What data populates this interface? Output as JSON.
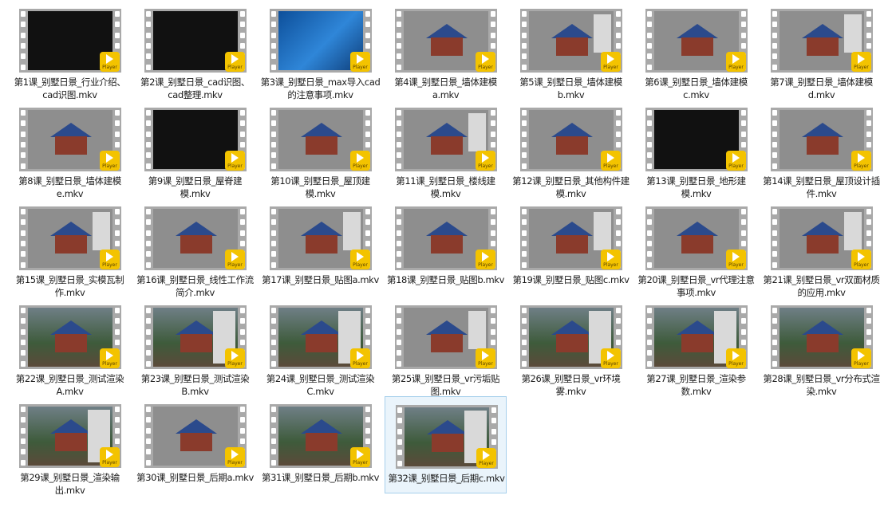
{
  "colors": {
    "badge": "#f3c300",
    "selection_border": "#a7d0ec"
  },
  "player_badge_label": "Player",
  "selected_index": 31,
  "files": [
    {
      "name": "第1课_别墅日景_行业介绍、cad识图.mkv",
      "thumb": "dark"
    },
    {
      "name": "第2课_别墅日景_cad识图、cad整理.mkv",
      "thumb": "dark"
    },
    {
      "name": "第3课_别墅日景_max导入cad的注意事项.mkv",
      "thumb": "blue"
    },
    {
      "name": "第4课_别墅日景_墙体建模a.mkv",
      "thumb": "gray"
    },
    {
      "name": "第5课_别墅日景_墙体建模b.mkv",
      "thumb": "gray"
    },
    {
      "name": "第6课_别墅日景_墙体建模c.mkv",
      "thumb": "gray"
    },
    {
      "name": "第7课_别墅日景_墙体建模d.mkv",
      "thumb": "gray"
    },
    {
      "name": "第8课_别墅日景_墙体建模e.mkv",
      "thumb": "gray"
    },
    {
      "name": "第9课_别墅日景_屋脊建模.mkv",
      "thumb": "dark"
    },
    {
      "name": "第10课_别墅日景_屋顶建模.mkv",
      "thumb": "gray"
    },
    {
      "name": "第11课_别墅日景_楼线建模.mkv",
      "thumb": "gray"
    },
    {
      "name": "第12课_别墅日景_其他构件建模.mkv",
      "thumb": "gray"
    },
    {
      "name": "第13课_别墅日景_地形建模.mkv",
      "thumb": "dark"
    },
    {
      "name": "第14课_别墅日景_屋顶设计插件.mkv",
      "thumb": "gray"
    },
    {
      "name": "第15课_别墅日景_实模瓦制作.mkv",
      "thumb": "gray"
    },
    {
      "name": "第16课_别墅日景_线性工作流简介.mkv",
      "thumb": "gray"
    },
    {
      "name": "第17课_别墅日景_贴图a.mkv",
      "thumb": "gray"
    },
    {
      "name": "第18课_别墅日景_贴图b.mkv",
      "thumb": "gray"
    },
    {
      "name": "第19课_别墅日景_贴图c.mkv",
      "thumb": "gray"
    },
    {
      "name": "第20课_别墅日景_vr代理注意事项.mkv",
      "thumb": "gray"
    },
    {
      "name": "第21课_别墅日景_vr双面材质的应用.mkv",
      "thumb": "gray"
    },
    {
      "name": "第22课_别墅日景_测试渲染A.mkv",
      "thumb": "render"
    },
    {
      "name": "第23课_别墅日景_测试渲染B.mkv",
      "thumb": "render"
    },
    {
      "name": "第24课_别墅日景_测试渲染C.mkv",
      "thumb": "render"
    },
    {
      "name": "第25课_别墅日景_vr污垢贴图.mkv",
      "thumb": "gray"
    },
    {
      "name": "第26课_别墅日景_vr环境雾.mkv",
      "thumb": "render"
    },
    {
      "name": "第27课_别墅日景_渲染参数.mkv",
      "thumb": "render"
    },
    {
      "name": "第28课_别墅日景_vr分布式渲染.mkv",
      "thumb": "render"
    },
    {
      "name": "第29课_别墅日景_渲染输出.mkv",
      "thumb": "render"
    },
    {
      "name": "第30课_别墅日景_后期a.mkv",
      "thumb": "gray"
    },
    {
      "name": "第31课_别墅日景_后期b.mkv",
      "thumb": "render"
    },
    {
      "name": "第32课_别墅日景_后期c.mkv",
      "thumb": "render"
    }
  ]
}
